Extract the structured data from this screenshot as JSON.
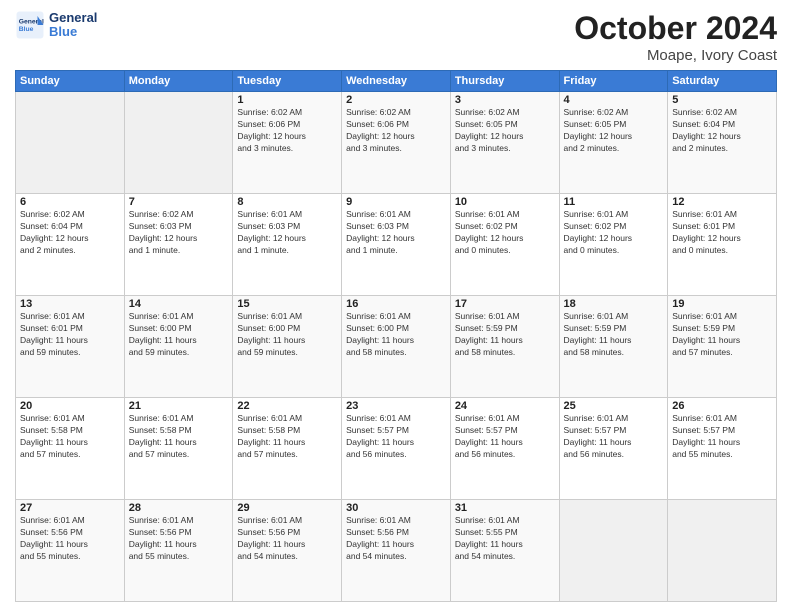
{
  "logo": {
    "line1": "General",
    "line2": "Blue"
  },
  "title": "October 2024",
  "subtitle": "Moape, Ivory Coast",
  "weekdays": [
    "Sunday",
    "Monday",
    "Tuesday",
    "Wednesday",
    "Thursday",
    "Friday",
    "Saturday"
  ],
  "weeks": [
    [
      {
        "day": "",
        "info": ""
      },
      {
        "day": "",
        "info": ""
      },
      {
        "day": "1",
        "info": "Sunrise: 6:02 AM\nSunset: 6:06 PM\nDaylight: 12 hours\nand 3 minutes."
      },
      {
        "day": "2",
        "info": "Sunrise: 6:02 AM\nSunset: 6:06 PM\nDaylight: 12 hours\nand 3 minutes."
      },
      {
        "day": "3",
        "info": "Sunrise: 6:02 AM\nSunset: 6:05 PM\nDaylight: 12 hours\nand 3 minutes."
      },
      {
        "day": "4",
        "info": "Sunrise: 6:02 AM\nSunset: 6:05 PM\nDaylight: 12 hours\nand 2 minutes."
      },
      {
        "day": "5",
        "info": "Sunrise: 6:02 AM\nSunset: 6:04 PM\nDaylight: 12 hours\nand 2 minutes."
      }
    ],
    [
      {
        "day": "6",
        "info": "Sunrise: 6:02 AM\nSunset: 6:04 PM\nDaylight: 12 hours\nand 2 minutes."
      },
      {
        "day": "7",
        "info": "Sunrise: 6:02 AM\nSunset: 6:03 PM\nDaylight: 12 hours\nand 1 minute."
      },
      {
        "day": "8",
        "info": "Sunrise: 6:01 AM\nSunset: 6:03 PM\nDaylight: 12 hours\nand 1 minute."
      },
      {
        "day": "9",
        "info": "Sunrise: 6:01 AM\nSunset: 6:03 PM\nDaylight: 12 hours\nand 1 minute."
      },
      {
        "day": "10",
        "info": "Sunrise: 6:01 AM\nSunset: 6:02 PM\nDaylight: 12 hours\nand 0 minutes."
      },
      {
        "day": "11",
        "info": "Sunrise: 6:01 AM\nSunset: 6:02 PM\nDaylight: 12 hours\nand 0 minutes."
      },
      {
        "day": "12",
        "info": "Sunrise: 6:01 AM\nSunset: 6:01 PM\nDaylight: 12 hours\nand 0 minutes."
      }
    ],
    [
      {
        "day": "13",
        "info": "Sunrise: 6:01 AM\nSunset: 6:01 PM\nDaylight: 11 hours\nand 59 minutes."
      },
      {
        "day": "14",
        "info": "Sunrise: 6:01 AM\nSunset: 6:00 PM\nDaylight: 11 hours\nand 59 minutes."
      },
      {
        "day": "15",
        "info": "Sunrise: 6:01 AM\nSunset: 6:00 PM\nDaylight: 11 hours\nand 59 minutes."
      },
      {
        "day": "16",
        "info": "Sunrise: 6:01 AM\nSunset: 6:00 PM\nDaylight: 11 hours\nand 58 minutes."
      },
      {
        "day": "17",
        "info": "Sunrise: 6:01 AM\nSunset: 5:59 PM\nDaylight: 11 hours\nand 58 minutes."
      },
      {
        "day": "18",
        "info": "Sunrise: 6:01 AM\nSunset: 5:59 PM\nDaylight: 11 hours\nand 58 minutes."
      },
      {
        "day": "19",
        "info": "Sunrise: 6:01 AM\nSunset: 5:59 PM\nDaylight: 11 hours\nand 57 minutes."
      }
    ],
    [
      {
        "day": "20",
        "info": "Sunrise: 6:01 AM\nSunset: 5:58 PM\nDaylight: 11 hours\nand 57 minutes."
      },
      {
        "day": "21",
        "info": "Sunrise: 6:01 AM\nSunset: 5:58 PM\nDaylight: 11 hours\nand 57 minutes."
      },
      {
        "day": "22",
        "info": "Sunrise: 6:01 AM\nSunset: 5:58 PM\nDaylight: 11 hours\nand 57 minutes."
      },
      {
        "day": "23",
        "info": "Sunrise: 6:01 AM\nSunset: 5:57 PM\nDaylight: 11 hours\nand 56 minutes."
      },
      {
        "day": "24",
        "info": "Sunrise: 6:01 AM\nSunset: 5:57 PM\nDaylight: 11 hours\nand 56 minutes."
      },
      {
        "day": "25",
        "info": "Sunrise: 6:01 AM\nSunset: 5:57 PM\nDaylight: 11 hours\nand 56 minutes."
      },
      {
        "day": "26",
        "info": "Sunrise: 6:01 AM\nSunset: 5:57 PM\nDaylight: 11 hours\nand 55 minutes."
      }
    ],
    [
      {
        "day": "27",
        "info": "Sunrise: 6:01 AM\nSunset: 5:56 PM\nDaylight: 11 hours\nand 55 minutes."
      },
      {
        "day": "28",
        "info": "Sunrise: 6:01 AM\nSunset: 5:56 PM\nDaylight: 11 hours\nand 55 minutes."
      },
      {
        "day": "29",
        "info": "Sunrise: 6:01 AM\nSunset: 5:56 PM\nDaylight: 11 hours\nand 54 minutes."
      },
      {
        "day": "30",
        "info": "Sunrise: 6:01 AM\nSunset: 5:56 PM\nDaylight: 11 hours\nand 54 minutes."
      },
      {
        "day": "31",
        "info": "Sunrise: 6:01 AM\nSunset: 5:55 PM\nDaylight: 11 hours\nand 54 minutes."
      },
      {
        "day": "",
        "info": ""
      },
      {
        "day": "",
        "info": ""
      }
    ]
  ]
}
